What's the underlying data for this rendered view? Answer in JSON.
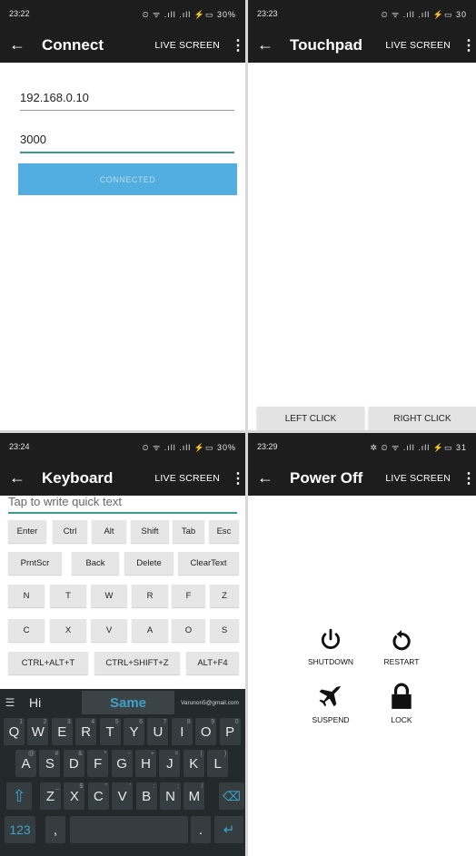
{
  "connect": {
    "status": {
      "time": "23:22",
      "icons": "⏲ ᯤ .ıll .ıll ⚡▭ 30%"
    },
    "toolbar": {
      "title": "Connect",
      "live": "LIVE SCREEN"
    },
    "ip_value": "192.168.0.10",
    "port_value": "3000",
    "connect_button": "CONNECTED"
  },
  "touchpad": {
    "status": {
      "time": "23:23",
      "icons": "⏲ ᯤ .ıll .ıll ⚡▭ 30"
    },
    "toolbar": {
      "title": "Touchpad",
      "live": "LIVE SCREEN"
    },
    "left_click": "LEFT CLICK",
    "right_click": "RIGHT CLICK"
  },
  "keyboard_screen": {
    "status": {
      "time": "23:24",
      "icons": "⏲ ᯤ .ıll .ıll ⚡▭ 30%"
    },
    "toolbar": {
      "title": "Keyboard",
      "live": "LIVE SCREEN"
    },
    "quick_text_placeholder": "Tap to write quick text",
    "row1": [
      "Enter",
      "Ctrl",
      "Alt",
      "Shift",
      "Tab",
      "Esc"
    ],
    "row2": [
      "PrntScr",
      "Back",
      "Delete",
      "ClearText"
    ],
    "row3": [
      "N",
      "T",
      "W",
      "R",
      "F",
      "Z"
    ],
    "row4": [
      "C",
      "X",
      "V",
      "A",
      "O",
      "S"
    ],
    "row5": [
      "CTRL+ALT+T",
      "CTRL+SHIFT+Z",
      "ALT+F4"
    ],
    "ime": {
      "suggestions": [
        "Hi",
        "Same",
        "Varunon5@gmail.com"
      ],
      "row1": [
        "Q",
        "W",
        "E",
        "R",
        "T",
        "Y",
        "U",
        "I",
        "O",
        "P"
      ],
      "row1_sub": [
        "1",
        "2",
        "3",
        "4",
        "5",
        "6",
        "7",
        "8",
        "9",
        "0"
      ],
      "row2": [
        "A",
        "S",
        "D",
        "F",
        "G",
        "H",
        "J",
        "K",
        "L"
      ],
      "row2_sub": [
        "@",
        "#",
        "&",
        "*",
        "-",
        "+",
        "=",
        "(",
        ")"
      ],
      "row3": [
        "Z",
        "X",
        "C",
        "V",
        "B",
        "N",
        "M"
      ],
      "row3_sub": [
        "_",
        "$",
        "\"",
        "'",
        ":",
        ";",
        "/"
      ],
      "numbers_key": "123",
      "comma_key": ",",
      "period_key": "."
    }
  },
  "power": {
    "status": {
      "time": "23:29",
      "icons": "✲ ⏲ ᯤ .ıll .ıll ⚡▭ 31"
    },
    "toolbar": {
      "title": "Power Off",
      "live": "LIVE SCREEN"
    },
    "shutdown": "SHUTDOWN",
    "restart": "RESTART",
    "suspend": "SUSPEND",
    "lock": "LOCK"
  }
}
